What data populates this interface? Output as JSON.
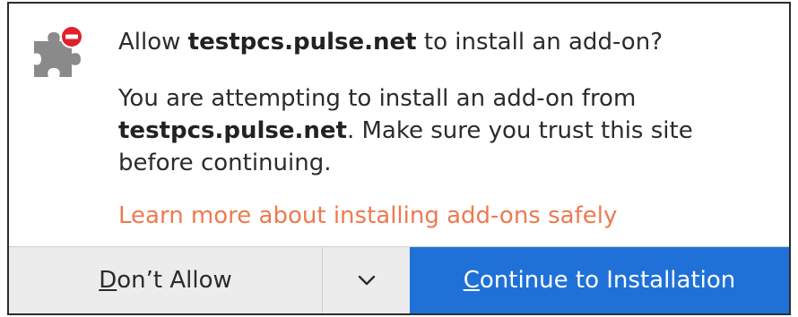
{
  "dialog": {
    "title_prefix": "Allow ",
    "title_site": "testpcs.pulse.net",
    "title_suffix": " to install an add-on?",
    "message_line1": "You are attempting to install an add-on from",
    "message_site": "testpcs.pulse.net",
    "message_rest": ". Make sure you trust this site",
    "message_line3": "before continuing.",
    "learn_more": "Learn more about installing add-ons safely"
  },
  "buttons": {
    "dont_allow_mnemonic": "D",
    "dont_allow_rest": "on’t Allow",
    "dropdown_icon": "chevron-down-icon",
    "continue_mnemonic": "C",
    "continue_rest": "ontinue to Installation"
  },
  "colors": {
    "link": "#ee7a4f",
    "primary_button": "#1f71d8",
    "secondary_button": "#ececec",
    "blocked_badge": "#e0202b",
    "puzzle_icon": "#8a8a8a"
  },
  "icons": {
    "addon": "puzzle-piece-blocked-icon"
  }
}
